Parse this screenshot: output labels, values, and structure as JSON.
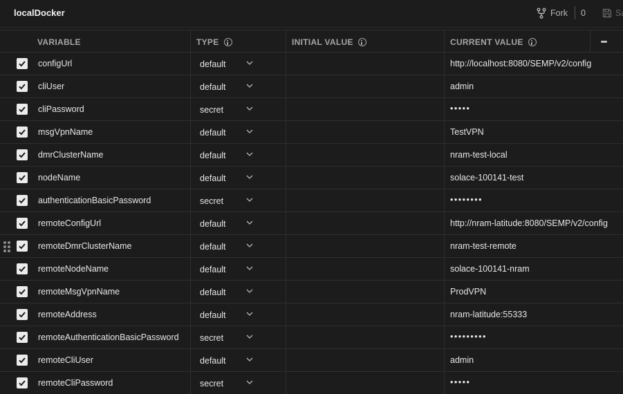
{
  "environment": {
    "title": "localDocker"
  },
  "toolbar": {
    "fork_label": "Fork",
    "fork_count": "0",
    "save_label": "Sa"
  },
  "table": {
    "headers": {
      "variable": "VARIABLE",
      "type": "TYPE",
      "initial_value": "INITIAL VALUE",
      "current_value": "CURRENT VALUE"
    },
    "more_label": "•••",
    "rows": [
      {
        "enabled": true,
        "variable": "configUrl",
        "type": "default",
        "initial_value": "",
        "current_value": "http://localhost:8080/SEMP/v2/config"
      },
      {
        "enabled": true,
        "variable": "cliUser",
        "type": "default",
        "initial_value": "",
        "current_value": "admin"
      },
      {
        "enabled": true,
        "variable": "cliPassword",
        "type": "secret",
        "initial_value": "",
        "current_value": "•••••"
      },
      {
        "enabled": true,
        "variable": "msgVpnName",
        "type": "default",
        "initial_value": "",
        "current_value": "TestVPN"
      },
      {
        "enabled": true,
        "variable": "dmrClusterName",
        "type": "default",
        "initial_value": "",
        "current_value": "nram-test-local"
      },
      {
        "enabled": true,
        "variable": "nodeName",
        "type": "default",
        "initial_value": "",
        "current_value": "solace-100141-test"
      },
      {
        "enabled": true,
        "variable": "authenticationBasicPassword",
        "type": "secret",
        "initial_value": "",
        "current_value": "••••••••"
      },
      {
        "enabled": true,
        "variable": "remoteConfigUrl",
        "type": "default",
        "initial_value": "",
        "current_value": "http://nram-latitude:8080/SEMP/v2/config"
      },
      {
        "enabled": true,
        "variable": "remoteDmrClusterName",
        "type": "default",
        "initial_value": "",
        "current_value": "nram-test-remote",
        "drag_handle": true
      },
      {
        "enabled": true,
        "variable": "remoteNodeName",
        "type": "default",
        "initial_value": "",
        "current_value": "solace-100141-nram"
      },
      {
        "enabled": true,
        "variable": "remoteMsgVpnName",
        "type": "default",
        "initial_value": "",
        "current_value": "ProdVPN"
      },
      {
        "enabled": true,
        "variable": "remoteAddress",
        "type": "default",
        "initial_value": "",
        "current_value": "nram-latitude:55333"
      },
      {
        "enabled": true,
        "variable": "remoteAuthenticationBasicPassword",
        "type": "secret",
        "initial_value": "",
        "current_value": "•••••••••"
      },
      {
        "enabled": true,
        "variable": "remoteCliUser",
        "type": "default",
        "initial_value": "",
        "current_value": "admin"
      },
      {
        "enabled": true,
        "variable": "remoteCliPassword",
        "type": "secret",
        "initial_value": "",
        "current_value": "•••••"
      }
    ]
  },
  "icons": {
    "fork": "fork-icon",
    "save": "save-icon",
    "info": "info-icon",
    "checkbox": "checkmark-icon",
    "dropdown": "chevron-down-icon",
    "drag": "drag-handle-icon"
  },
  "colors": {
    "background": "#1c1c1c",
    "grid": "#2f2f2f",
    "text": "#e6e6e6",
    "header_text": "#a6a6a6",
    "checkbox": "#ececec"
  }
}
